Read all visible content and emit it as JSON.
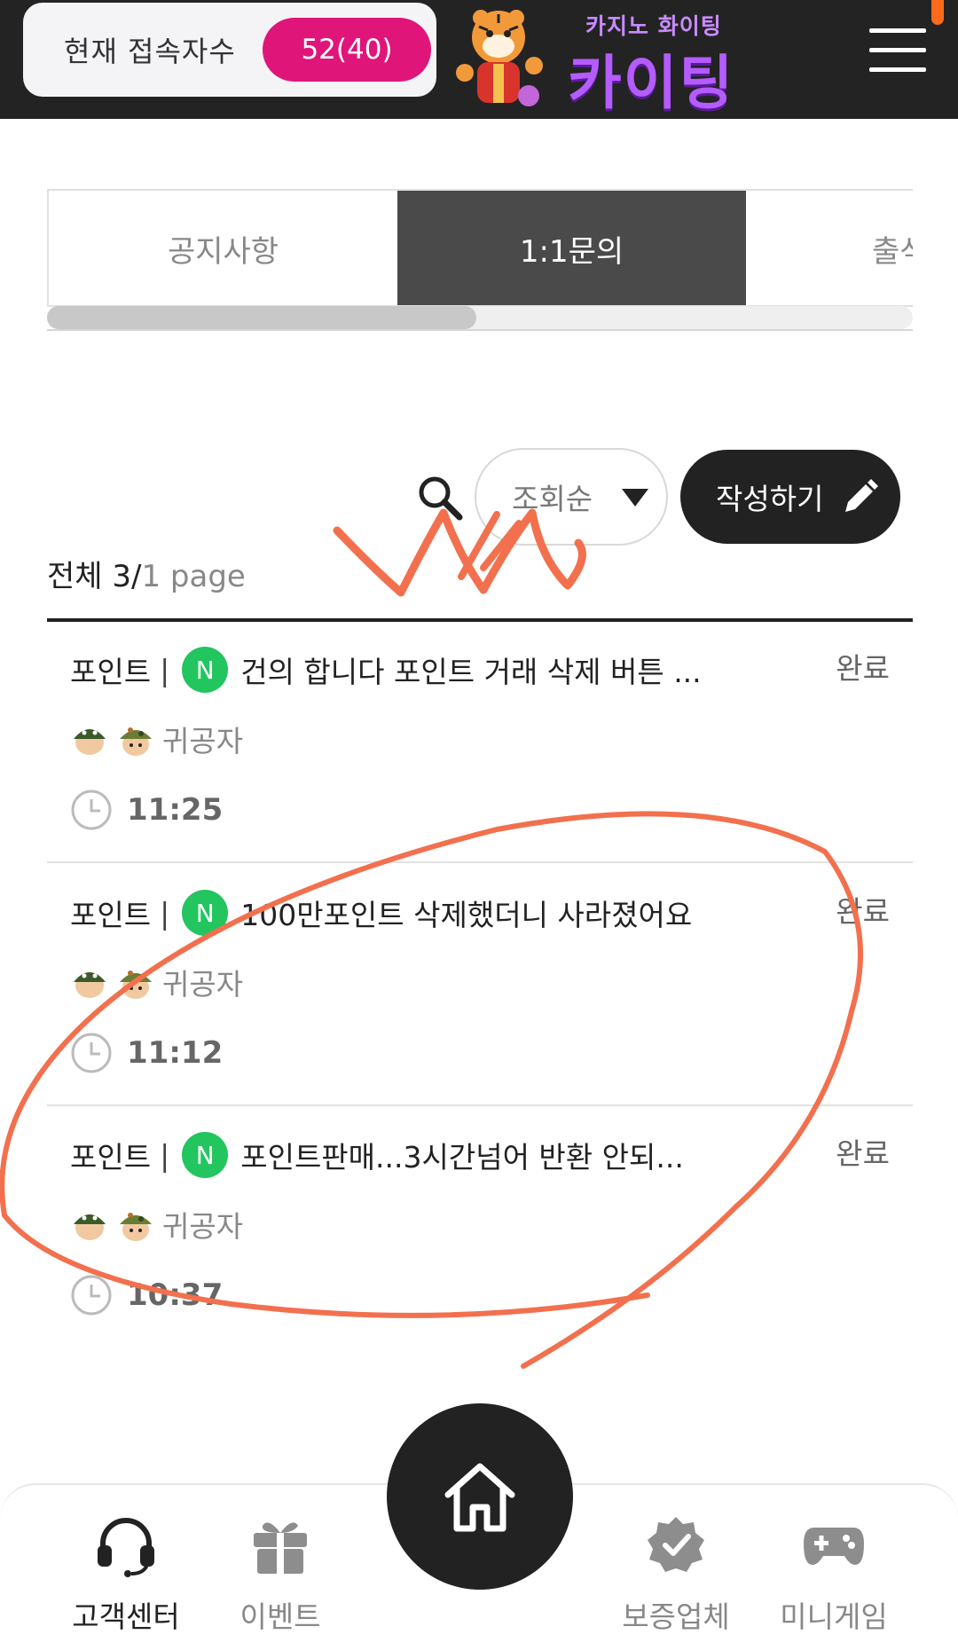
{
  "header": {
    "online_label": "현재 접속자수",
    "online_count": "52(40)",
    "logo_small": "카지노 화이팅",
    "logo_big": "카이팅"
  },
  "tabs": [
    {
      "label": "공지사항",
      "active": false
    },
    {
      "label": "1:1문의",
      "active": true
    },
    {
      "label": "출석",
      "active": false
    }
  ],
  "controls": {
    "search_icon": "search-icon",
    "sort_label": "조회순",
    "write_label": "작성하기"
  },
  "summary": {
    "total": "전체 3/",
    "page": "1 page"
  },
  "posts": [
    {
      "category": "포인트",
      "sep": "|",
      "badge": "N",
      "title": "건의 합니다 포인트 거래 삭제 버튼 ...",
      "status": "완료",
      "author": "귀공자",
      "time": "11:25"
    },
    {
      "category": "포인트",
      "sep": "|",
      "badge": "N",
      "title": "100만포인트 삭제했더니 사라졌어요",
      "status": "완료",
      "author": "귀공자",
      "time": "11:12"
    },
    {
      "category": "포인트",
      "sep": "|",
      "badge": "N",
      "title": "포인트판매...3시간넘어 반환 안되...",
      "status": "완료",
      "author": "귀공자",
      "time": "10:37"
    }
  ],
  "bottom_nav": [
    {
      "label": "고객센터",
      "icon": "headset-icon",
      "active": true
    },
    {
      "label": "이벤트",
      "icon": "gift-icon",
      "active": false
    },
    {
      "label": "홈",
      "icon": "home-icon",
      "active": false
    },
    {
      "label": "보증업체",
      "icon": "verified-badge-icon",
      "active": false
    },
    {
      "label": "미니게임",
      "icon": "gamepad-icon",
      "active": false
    }
  ],
  "colors": {
    "header_bg": "#232323",
    "count_badge": "#e0157a",
    "new_badge": "#22c55e",
    "active_tab": "#4a4a4a",
    "annotation": "#f2704e"
  }
}
